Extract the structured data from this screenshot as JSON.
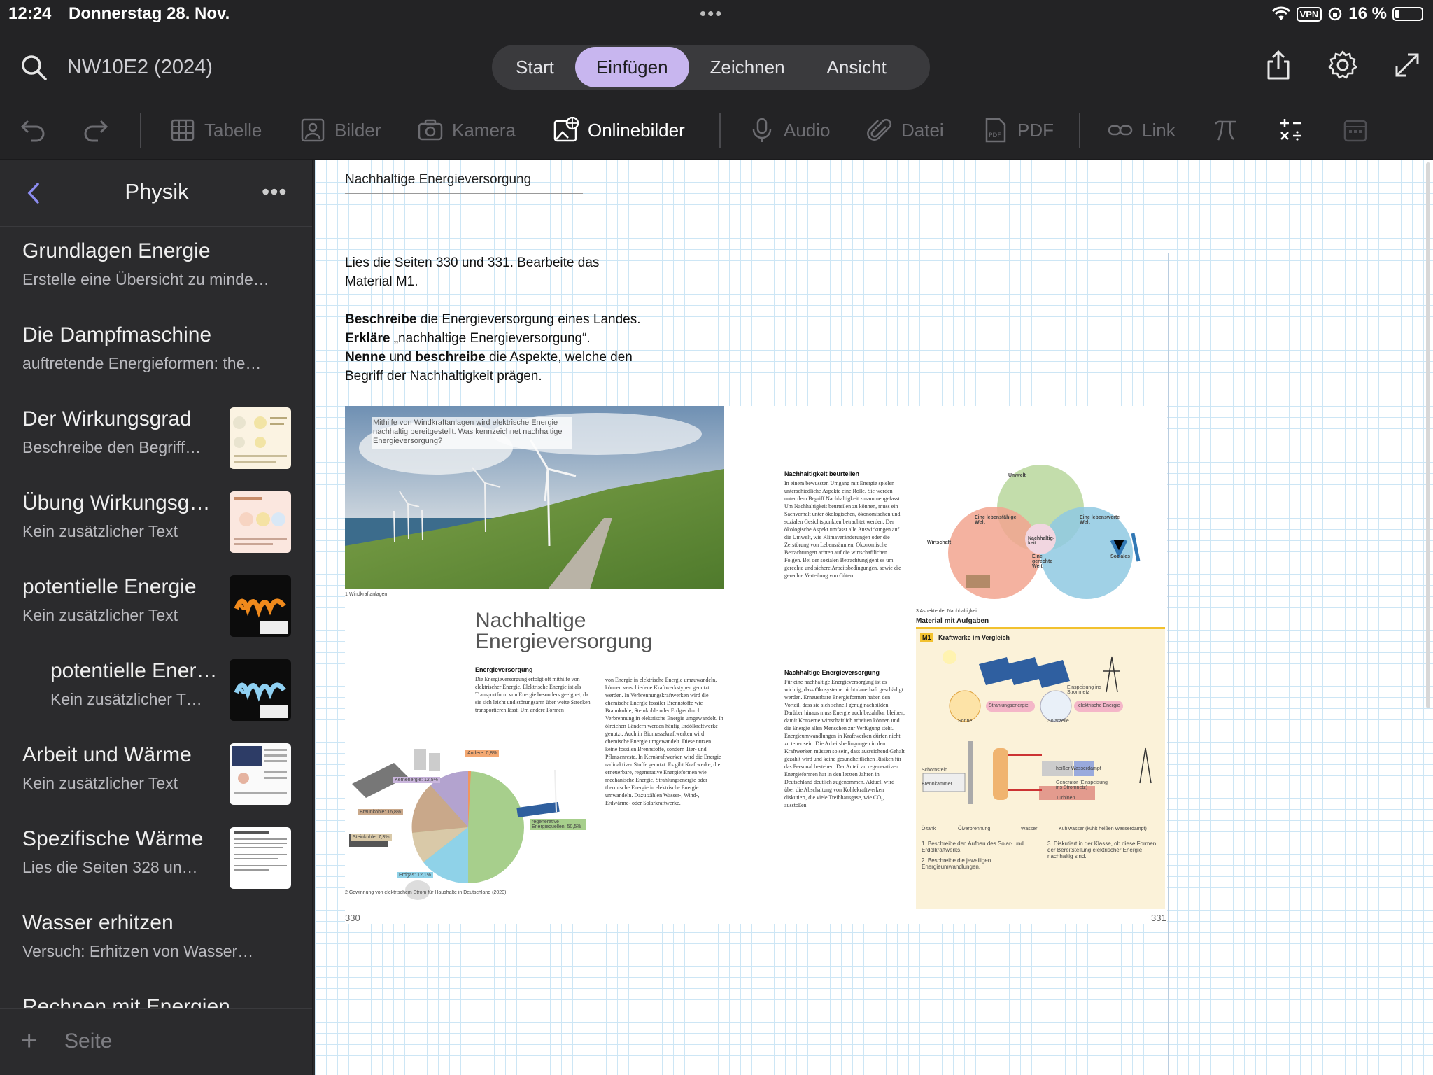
{
  "status": {
    "time": "12:24",
    "date": "Donnerstag 28. Nov.",
    "vpn": "VPN",
    "battery": "16 %"
  },
  "notebook": {
    "title": "NW10E2 (2024)"
  },
  "tabs": [
    {
      "label": "Start"
    },
    {
      "label": "Einfügen"
    },
    {
      "label": "Zeichnen"
    },
    {
      "label": "Ansicht"
    }
  ],
  "toolbar": {
    "table": "Tabelle",
    "images": "Bilder",
    "camera": "Kamera",
    "online": "Onlinebilder",
    "audio": "Audio",
    "file": "Datei",
    "pdf": "PDF",
    "link": "Link"
  },
  "sidebar": {
    "section": "Physik",
    "add_label": "Seite",
    "pages": [
      {
        "title": "Grundlagen Energie",
        "sub": "Erstelle eine Übersicht zu minde…"
      },
      {
        "title": "Die Dampfmaschine",
        "sub": "auftretende Energieformen:  the…"
      },
      {
        "title": "Der Wirkungsgrad",
        "sub": "Beschreibe den Begriff…"
      },
      {
        "title": "Übung Wirkungsg…",
        "sub": "Kein zusätzlicher Text"
      },
      {
        "title": "potentielle Energie",
        "sub": "Kein zusätzlicher Text"
      },
      {
        "title": "potentielle Ener…",
        "sub": "Kein zusätzlicher T…"
      },
      {
        "title": "Arbeit und Wärme",
        "sub": "Kein zusätzlicher Text"
      },
      {
        "title": "Spezifische Wärme",
        "sub": "Lies die Seiten 328 un…"
      },
      {
        "title": "Wasser erhitzen",
        "sub": "Versuch: Erhitzen von Wasser…"
      },
      {
        "title": "Rechnen mit Energien",
        "sub": ""
      }
    ]
  },
  "page": {
    "heading": "Nachhaltige Energieversorgung",
    "line1": "Lies die Seiten 330 und 331. Bearbeite das",
    "line2": "Material M1.",
    "t1_bold": "Beschreibe",
    "t1_rest": " die Energieversorgung eines Landes.",
    "t2_bold": "Erkläre",
    "t2_rest": " „nachhaltige Energieversorgung“.",
    "t3_bold1": "Nenne",
    "t3_mid": " und ",
    "t3_bold2": "beschreibe",
    "t3_rest": " die Aspekte, welche den",
    "t3_line2": "Begriff der Nachhaltigkeit prägen."
  },
  "book": {
    "photo_caption": "Mithilfe von Windkraftanlagen wird elektrische Energie nachhaltig bereitgestellt. Was kennzeichnet nachhaltige Energieversorgung?",
    "fig1": "1  Windkraftanlagen",
    "title1": "Nachhaltige",
    "title2": "Energieversorgung",
    "sec1_head": "Energieversorgung",
    "sec1_text": "Die Energieversorgung erfolgt oft mithilfe von elektrischer Energie. Elektrische Energie ist als Transportform von Energie besonders geeignet, da sie sich leicht und störungsarm über weite Strecken transportieren lässt. Um andere Formen",
    "sec1b_text": "von Energie in elektrische Energie umzuwandeln, können verschiedene Kraftwerkstypen genutzt werden. In Verbrennungskraftwerken wird die chemische Energie fossiler Brennstoffe wie Braunkohle, Steinkohle oder Erdgas durch Verbrennung in elektrische Energie umgewandelt. In ölreichen Ländern werden häufig Erdölkraftwerke genutzt. Auch in Biomassekraftwerken wird chemische Energie umgewandelt. Diese nutzen keine fossilen Brennstoffe, sondern Tier- und Pflanzenreste. In Kernkraftwerken wird die Energie radioaktiver Stoffe genutzt. Es gibt Kraftwerke, die erneuerbare, regenerative Energieformen wie mechanische Energie, Strahlungsenergie oder thermische Energie in elektrische Energie umwandeln. Dazu zählen Wasser-, Wind-, Erdwärme- oder Solarkraftwerke.",
    "pie_caption": "2  Gewinnung von elektrischem Strom für Haushalte in Deutschland (2020)",
    "pie_labels": [
      "Kernenergie: 12,5%",
      "Andere: 0,8%",
      "Braunkohle: 16,8%",
      "Steinkohle: 7,3%",
      "regenerative Energiequellen: 50,5%",
      "Erdgas: 12,1%"
    ],
    "sec2_head": "Nachhaltigkeit beurteilen",
    "sec2_text": "In einem bewussten Umgang mit Energie spielen unterschiedliche Aspekte eine Rolle. Sie werden unter dem Begriff Nachhaltigkeit zusammengefasst. Um Nachhaltigkeit beurteilen zu können, muss ein Sachverhalt unter ökologischen, ökonomischen und sozialen Gesichtspunkten betrachtet werden. Der ökologische Aspekt umfasst alle Auswirkungen auf die Umwelt, wie Klimaveränderungen oder die Zerstörung von Lebensräumen. Ökonomische Betrachtungen achten auf die wirtschaftlichen Folgen. Bei der sozialen Betrachtung geht es um gerechte und sichere Arbeitsbedingungen, sowie die gerechte Verteilung von Gütern.",
    "sec3_head": "Nachhaltige Energieversorgung",
    "sec3_text": "Für eine nachhaltige Energieversorgung ist es wichtig, dass Ökosysteme nicht dauerhaft geschädigt werden. Erneuerbare Energieformen haben den Vorteil, dass sie sich schnell genug nachbilden. Darüber hinaus muss Energie auch bezahlbar bleiben, damit Konzerne wirtschaftlich arbeiten können und die Energie allen Menschen zur Verfügung steht. Energieumwandlungen in Kraftwerken dürfen nicht zu teuer sein. Die Arbeitsbedingungen in den Kraftwerken müssen so sein, dass ausreichend Gehalt gezahlt wird und keine gesundheitlichen Risiken für das Personal bestehen. Der Anteil an regenerativen Energieformen hat in den letzten Jahren in Deutschland deutlich zugenommen. Aktuell wird über die Abschaltung von Kohlekraftwerken diskutiert, die viele Treibhausgase, wie CO₂, ausstoßen.",
    "venn_caption": "3  Aspekte der Nachhaltigkeit",
    "venn_labels": [
      "Umwelt",
      "Wirtschaft",
      "Soziales",
      "Nachhaltig-keit",
      "Eine lebensfähige Welt",
      "Eine lebenswerte Welt",
      "Eine gerechte Welt"
    ],
    "m1_section": "Material mit Aufgaben",
    "m1_badge": "M1",
    "m1_title": "Kraftwerke im Vergleich",
    "m1_labels": [
      "Einspeisung ins Stromnetz",
      "Sonne",
      "Strahlungsenergie",
      "Solarzelle",
      "elektrische Energie",
      "Schornstein",
      "Brennkammer",
      "heißer Wasserdampf",
      "Generator (Einspeisung ins Stromnetz)",
      "Turbinen",
      "Öltank",
      "Ölverbrennung",
      "Wasser",
      "Kühlwasser (kühlt heißen Wasserdampf)"
    ],
    "m1_task1": "1. Beschreibe den Aufbau des Solar- und Erdölkraftwerks.",
    "m1_task2": "2. Beschreibe die jeweiligen Energieumwandlungen.",
    "m1_task3": "3. Diskutiert in der Klasse, ob diese Formen der Bereitstellung elektrischer Energie nachhaltig sind.",
    "page_left": "330",
    "page_right": "331"
  }
}
